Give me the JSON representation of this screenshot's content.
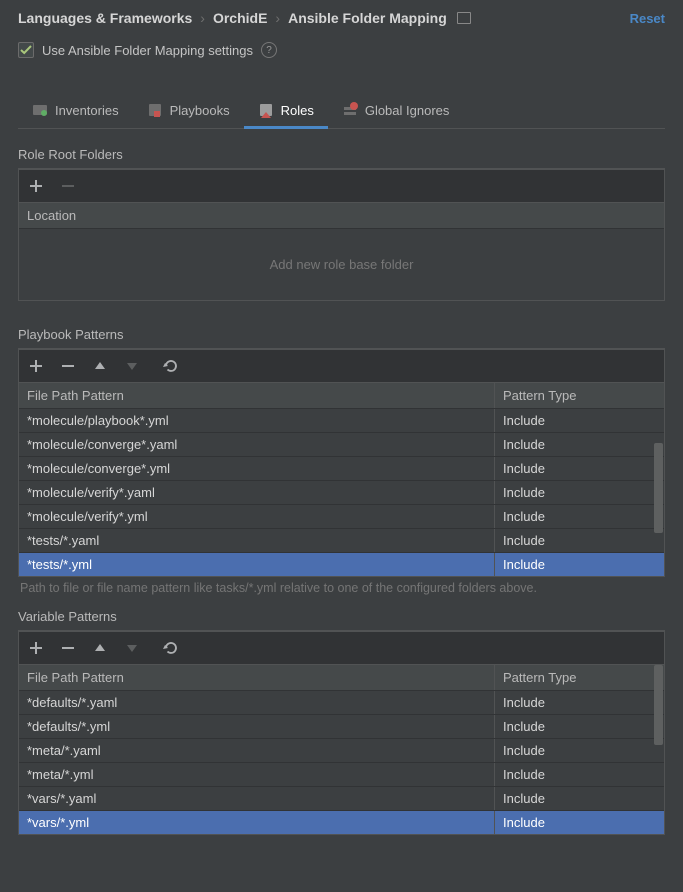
{
  "breadcrumb": {
    "a": "Languages & Frameworks",
    "b": "OrchidE",
    "c": "Ansible Folder Mapping",
    "reset": "Reset"
  },
  "checkboxRow": {
    "label": "Use Ansible Folder Mapping settings"
  },
  "tabs": {
    "inventories": "Inventories",
    "playbooks": "Playbooks",
    "roles": "Roles",
    "globalIgnores": "Global Ignores"
  },
  "sections": {
    "roleRoot": {
      "title": "Role Root Folders",
      "columns": {
        "location": "Location"
      },
      "emptyText": "Add new role base folder"
    },
    "playbookPatterns": {
      "title": "Playbook Patterns",
      "columns": {
        "path": "File Path Pattern",
        "type": "Pattern Type"
      },
      "hint": "Path to file or file name pattern like tasks/*.yml relative to one of the configured folders above.",
      "rows": [
        {
          "path": "*molecule/playbook*.yml",
          "type": "Include",
          "selected": false
        },
        {
          "path": "*molecule/converge*.yaml",
          "type": "Include",
          "selected": false
        },
        {
          "path": "*molecule/converge*.yml",
          "type": "Include",
          "selected": false
        },
        {
          "path": "*molecule/verify*.yaml",
          "type": "Include",
          "selected": false
        },
        {
          "path": "*molecule/verify*.yml",
          "type": "Include",
          "selected": false
        },
        {
          "path": "*tests/*.yaml",
          "type": "Include",
          "selected": false
        },
        {
          "path": "*tests/*.yml",
          "type": "Include",
          "selected": true
        }
      ]
    },
    "variablePatterns": {
      "title": "Variable Patterns",
      "columns": {
        "path": "File Path Pattern",
        "type": "Pattern Type"
      },
      "rows": [
        {
          "path": "*defaults/*.yaml",
          "type": "Include",
          "selected": false
        },
        {
          "path": "*defaults/*.yml",
          "type": "Include",
          "selected": false
        },
        {
          "path": "*meta/*.yaml",
          "type": "Include",
          "selected": false
        },
        {
          "path": "*meta/*.yml",
          "type": "Include",
          "selected": false
        },
        {
          "path": "*vars/*.yaml",
          "type": "Include",
          "selected": false
        },
        {
          "path": "*vars/*.yml",
          "type": "Include",
          "selected": true
        }
      ]
    }
  }
}
